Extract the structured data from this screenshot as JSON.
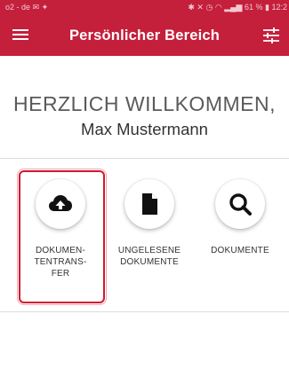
{
  "status_bar": {
    "carrier": "o2 - de",
    "battery": "61 %",
    "time": "12:2"
  },
  "app_bar": {
    "title": "Persönlicher Bereich",
    "menu_icon": "hamburger-menu-icon",
    "filter_icon": "filter-settings-icon"
  },
  "welcome": {
    "greeting": "HERZLICH WILLKOMMEN,",
    "user_name": "Max Mustermann"
  },
  "tiles": [
    {
      "icon": "cloud-upload-icon",
      "label_lines": [
        "DOKUMEN-",
        "TENTRANS-",
        "FER"
      ],
      "selected": true
    },
    {
      "icon": "document-icon",
      "label_lines": [
        "UNGELESENE",
        "DOKUMENTE"
      ],
      "selected": false
    },
    {
      "icon": "search-icon",
      "label_lines": [
        "DOKUMENTE"
      ],
      "selected": false
    }
  ],
  "colors": {
    "brand": "#c41f3b",
    "highlight": "#d0192f"
  }
}
